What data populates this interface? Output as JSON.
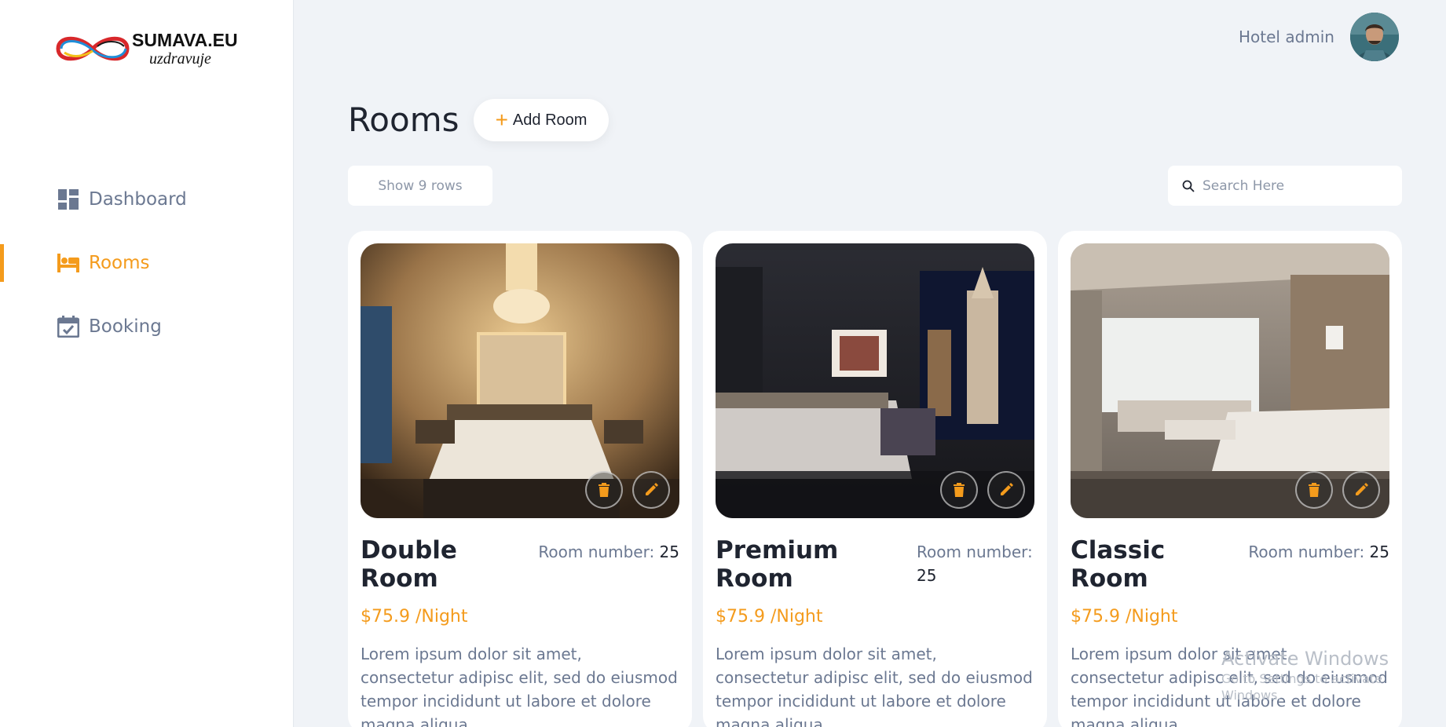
{
  "brand": {
    "title": "SUMAVA.EU",
    "subtitle": "uzdravuje"
  },
  "sidebar": {
    "items": [
      {
        "label": "Dashboard",
        "icon": "dashboard-icon",
        "active": false
      },
      {
        "label": "Rooms",
        "icon": "bed-icon",
        "active": true
      },
      {
        "label": "Booking",
        "icon": "calendar-check-icon",
        "active": false
      }
    ]
  },
  "header": {
    "user_name": "Hotel admin",
    "avatar_icon": "user-avatar"
  },
  "main": {
    "title": "Rooms",
    "add_button_label": "Add Room",
    "rows_select_label": "Show 9 rows",
    "search_placeholder": "Search Here"
  },
  "rooms": [
    {
      "name": "Double Room",
      "number_label": "Room number:",
      "number": "25",
      "price": "$75.9 /Night",
      "description": "Lorem ipsum dolor sit amet, consectetur adipisc elit, sed do eiusmod tempor incididunt ut labore et dolore magna aliqua."
    },
    {
      "name": "Premium Room",
      "number_label": "Room number:",
      "number": "25",
      "price": "$75.9 /Night",
      "description": "Lorem ipsum dolor sit amet, consectetur adipisc elit, sed do eiusmod tempor incididunt ut labore et dolore magna aliqua."
    },
    {
      "name": "Classic Room",
      "number_label": "Room number:",
      "number": "25",
      "price": "$75.9 /Night",
      "description": "Lorem ipsum dolor sit amet, consectetur adipisc elit, sed do eiusmod tempor incididunt ut labore et dolore magna aliqua."
    }
  ],
  "watermark": {
    "line1": "Activate Windows",
    "line2": "Go to Settings to activate Windows."
  },
  "colors": {
    "accent": "#f49b1c",
    "muted": "#6b7891",
    "background": "#f0f3f7"
  }
}
